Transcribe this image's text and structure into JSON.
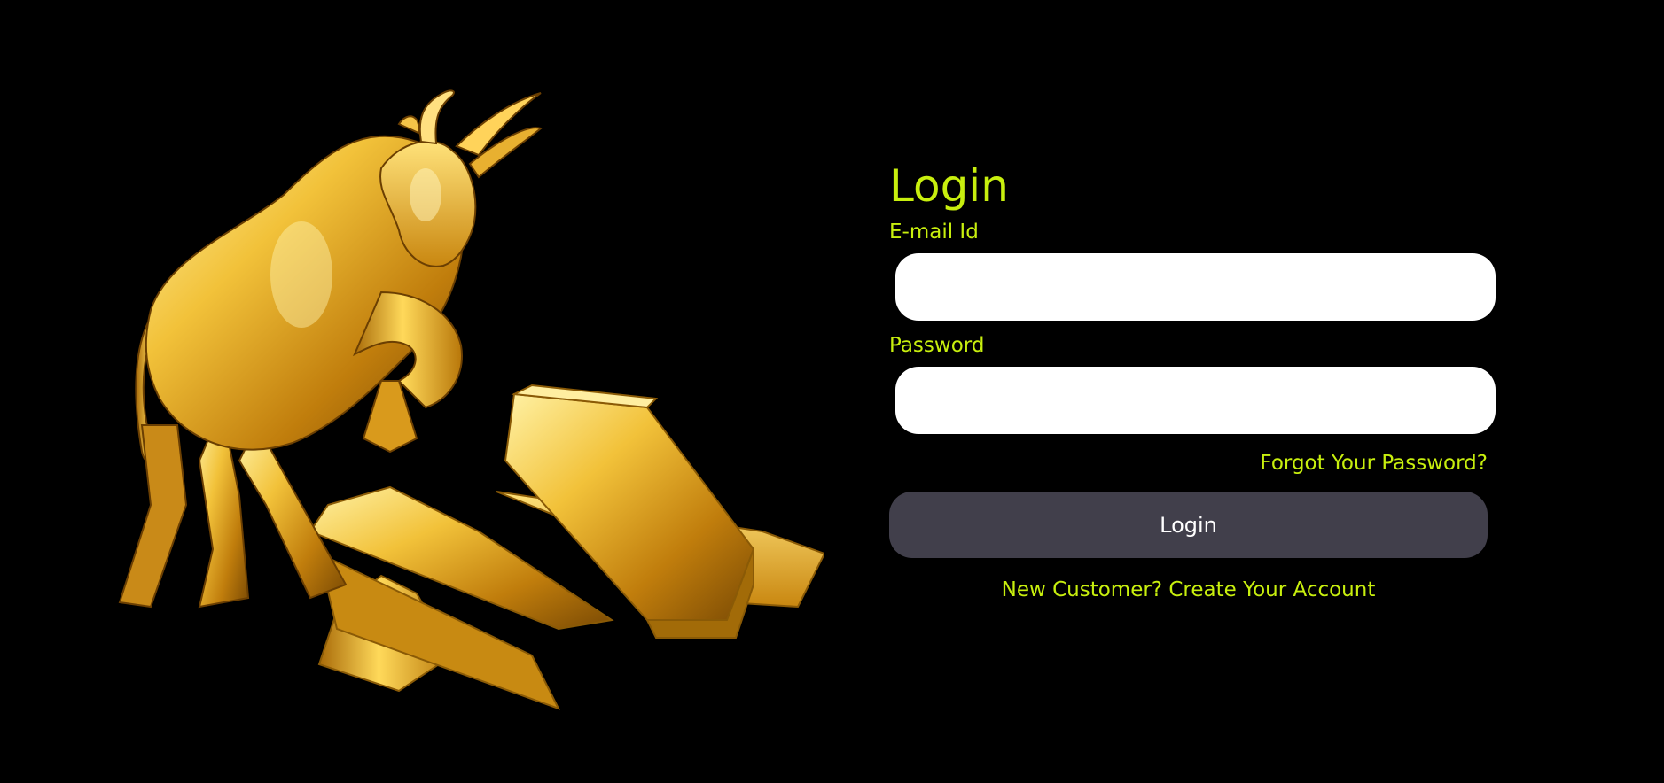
{
  "hero": {
    "image": "golden-bull-and-gold-bars-illustration"
  },
  "login": {
    "title": "Login",
    "email_label": "E-mail Id",
    "email_value": "",
    "password_label": "Password",
    "password_value": "",
    "forgot_password": "Forgot Your Password?",
    "submit_label": "Login",
    "register_link": "New Customer? Create Your Account"
  },
  "colors": {
    "background": "#000000",
    "accent": "#c8ef0e",
    "button": "#413f4b",
    "input": "#ffffff",
    "gold": "#e0a520"
  }
}
